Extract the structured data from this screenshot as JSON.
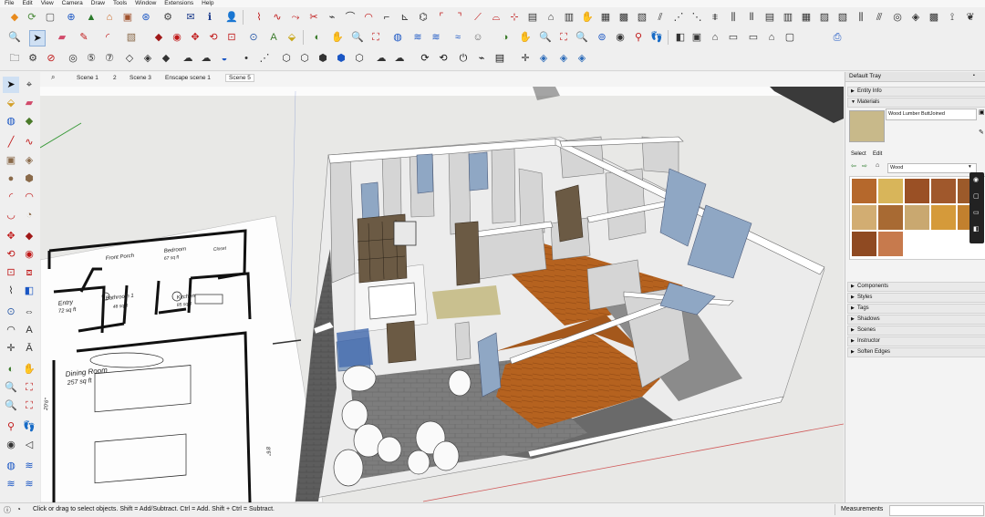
{
  "menu": [
    "File",
    "Edit",
    "View",
    "Camera",
    "Draw",
    "Tools",
    "Window",
    "Extensions",
    "Help"
  ],
  "scenes": [
    "Scene 1",
    "2",
    "Scene 3",
    "Enscape scene 1",
    "Scene 5"
  ],
  "tray": {
    "title": "Default Tray",
    "entity_info": "Entity Info",
    "materials": "Materials",
    "material_name": "Wood Lumber ButtJoined",
    "select_tab": "Select",
    "edit_tab": "Edit",
    "library": "Wood",
    "panels": [
      "Components",
      "Styles",
      "Tags",
      "Shadows",
      "Scenes",
      "Instructor",
      "Soften Edges"
    ],
    "swatch_colors": [
      "#b5682c",
      "#d8b55a",
      "#9a5025",
      "#a0582c",
      "#9c5a2a",
      "#d2ad72",
      "#a86a33",
      "#c9a870",
      "#d59a3a",
      "#c2802e",
      "#8f4a22",
      "#c77a4d"
    ]
  },
  "floorplan": {
    "rooms": [
      {
        "name": "Entry",
        "area": "72 sq ft"
      },
      {
        "name": "Bathroom 1",
        "area": "48 sq ft"
      },
      {
        "name": "Kitchen",
        "area": "85 sq ft"
      },
      {
        "name": "Dining Room",
        "area": "257 sq ft"
      },
      {
        "name": "Bedroom",
        "area": "67 sq ft"
      },
      {
        "name": "Closet",
        "area": ""
      },
      {
        "name": "Front Porch",
        "area": ""
      }
    ],
    "dims": [
      "20'6\"",
      "8'6\""
    ]
  },
  "status": {
    "hint": "Click or drag to select objects. Shift = Add/Subtract. Ctrl = Add. Shift + Ctrl = Subtract.",
    "measurements_label": "Measurements"
  },
  "colors": {
    "floor_wood": "#b5621f",
    "tile": "#7b7b7b",
    "wall": "#c9c9c9",
    "window": "#8fa7c4"
  }
}
